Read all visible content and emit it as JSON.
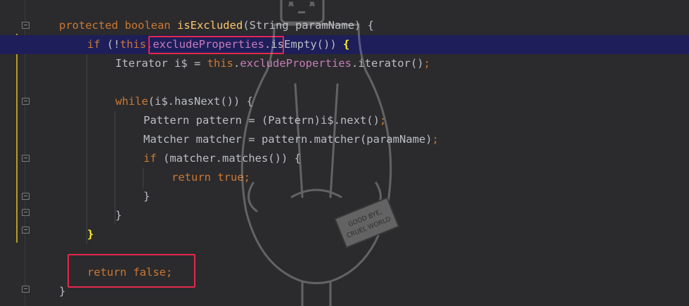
{
  "code": {
    "lines": [
      {
        "tokens": [
          [
            "kw",
            "protected boolean "
          ],
          [
            "fn",
            "isExcluded"
          ],
          [
            "plain",
            "(String paramName) {"
          ]
        ]
      },
      {
        "tokens": [
          [
            "kw",
            "if "
          ],
          [
            "plain",
            "(!"
          ],
          [
            "kw",
            "this"
          ],
          [
            "field",
            ".excludeProperties"
          ],
          [
            "plain",
            "."
          ],
          [
            "plain",
            "isEmpty()) "
          ],
          [
            "brace-y",
            "{"
          ]
        ]
      },
      {
        "tokens": [
          [
            "plain",
            "Iterator i$ = "
          ],
          [
            "kw",
            "this"
          ],
          [
            "plain",
            "."
          ],
          [
            "field",
            "excludeProperties"
          ],
          [
            "plain",
            ".iterator()"
          ],
          [
            "punct",
            ";"
          ]
        ]
      },
      {
        "tokens": []
      },
      {
        "tokens": [
          [
            "kw",
            "while"
          ],
          [
            "plain",
            "(i$.hasNext()) {"
          ]
        ]
      },
      {
        "tokens": [
          [
            "plain",
            "Pattern pattern = (Pattern)i$.next()"
          ],
          [
            "punct",
            ";"
          ]
        ]
      },
      {
        "tokens": [
          [
            "plain",
            "Matcher matcher = pattern.matcher(paramName)"
          ],
          [
            "punct",
            ";"
          ]
        ]
      },
      {
        "tokens": [
          [
            "kw",
            "if "
          ],
          [
            "plain",
            "(matcher.matches()) {"
          ]
        ]
      },
      {
        "tokens": [
          [
            "kw",
            "return true"
          ],
          [
            "punct",
            ";"
          ]
        ]
      },
      {
        "tokens": [
          [
            "plain",
            "}"
          ]
        ]
      },
      {
        "tokens": [
          [
            "plain",
            "}"
          ]
        ]
      },
      {
        "tokens": [
          [
            "brace-y",
            "}"
          ]
        ]
      },
      {
        "tokens": []
      },
      {
        "tokens": [
          [
            "kw",
            "return false"
          ],
          [
            "punct",
            ";"
          ]
        ]
      },
      {
        "tokens": [
          [
            "plain",
            "}"
          ]
        ]
      }
    ]
  },
  "illustration": {
    "sign_line1": "GOOD BYE,",
    "sign_line2": "CRUEL WORLD"
  }
}
